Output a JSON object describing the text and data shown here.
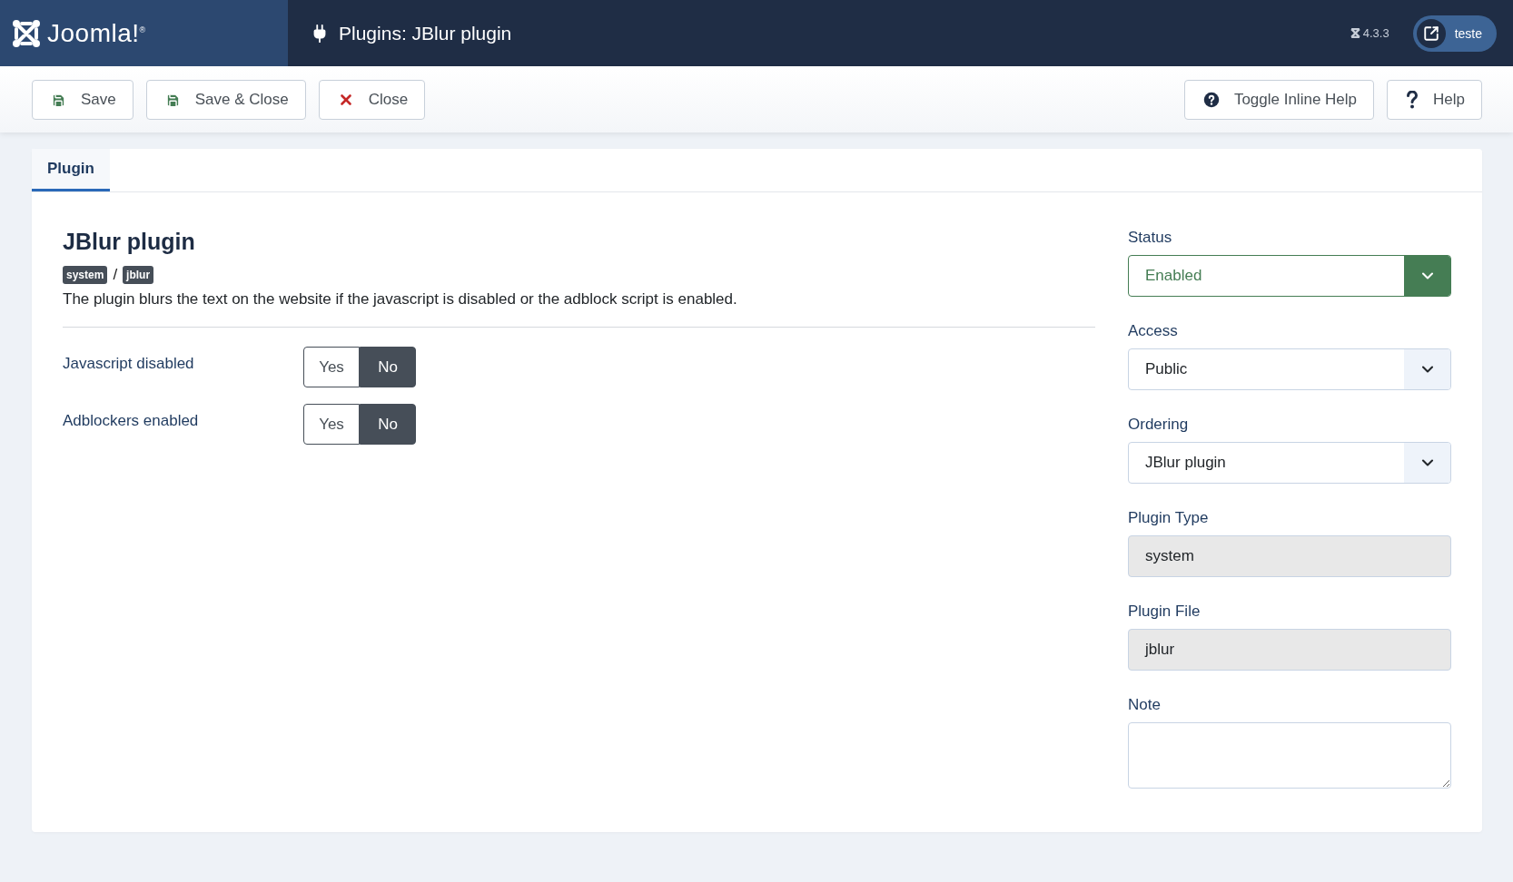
{
  "header": {
    "brand": "Joomla!$^{®}$",
    "title": "Plugins: JBlur plugin",
    "version": "4.3.3",
    "user": "teste"
  },
  "toolbar": {
    "left": [
      {
        "kind": "save",
        "label": "Save"
      },
      {
        "kind": "save",
        "label": "Save & Close"
      },
      {
        "kind": "close",
        "label": "Close"
      }
    ],
    "right": [
      {
        "kind": "inline-help",
        "label": "Toggle Inline Help"
      },
      {
        "kind": "help",
        "label": "Help"
      }
    ]
  },
  "tabs": [
    {
      "label": "Plugin",
      "selected": true
    }
  ],
  "plugin": {
    "title": "JBlur plugin",
    "tags": [
      "system",
      "jblur"
    ],
    "separator": "/",
    "description": "The plugin blurs the text on the website if the javascript is disabled or the adblock script is enabled."
  },
  "options": [
    {
      "label": "Javascript disabled",
      "choices": [
        {
          "label": "Yes",
          "selected": false
        },
        {
          "label": "No",
          "selected": true
        }
      ]
    },
    {
      "label": "Adblockers enabled",
      "choices": [
        {
          "label": "Yes",
          "selected": false
        },
        {
          "label": "No",
          "selected": true
        }
      ]
    }
  ],
  "fields": [
    {
      "kind": "status",
      "label": "Status",
      "value": "Enabled"
    },
    {
      "kind": "select",
      "label": "Access",
      "value": "Public"
    },
    {
      "kind": "select",
      "label": "Ordering",
      "value": "JBlur plugin"
    },
    {
      "kind": "readonly",
      "label": "Plugin Type",
      "value": "system"
    },
    {
      "kind": "readonly",
      "label": "Plugin File",
      "value": "jblur"
    },
    {
      "kind": "textarea",
      "label": "Note"
    }
  ]
}
